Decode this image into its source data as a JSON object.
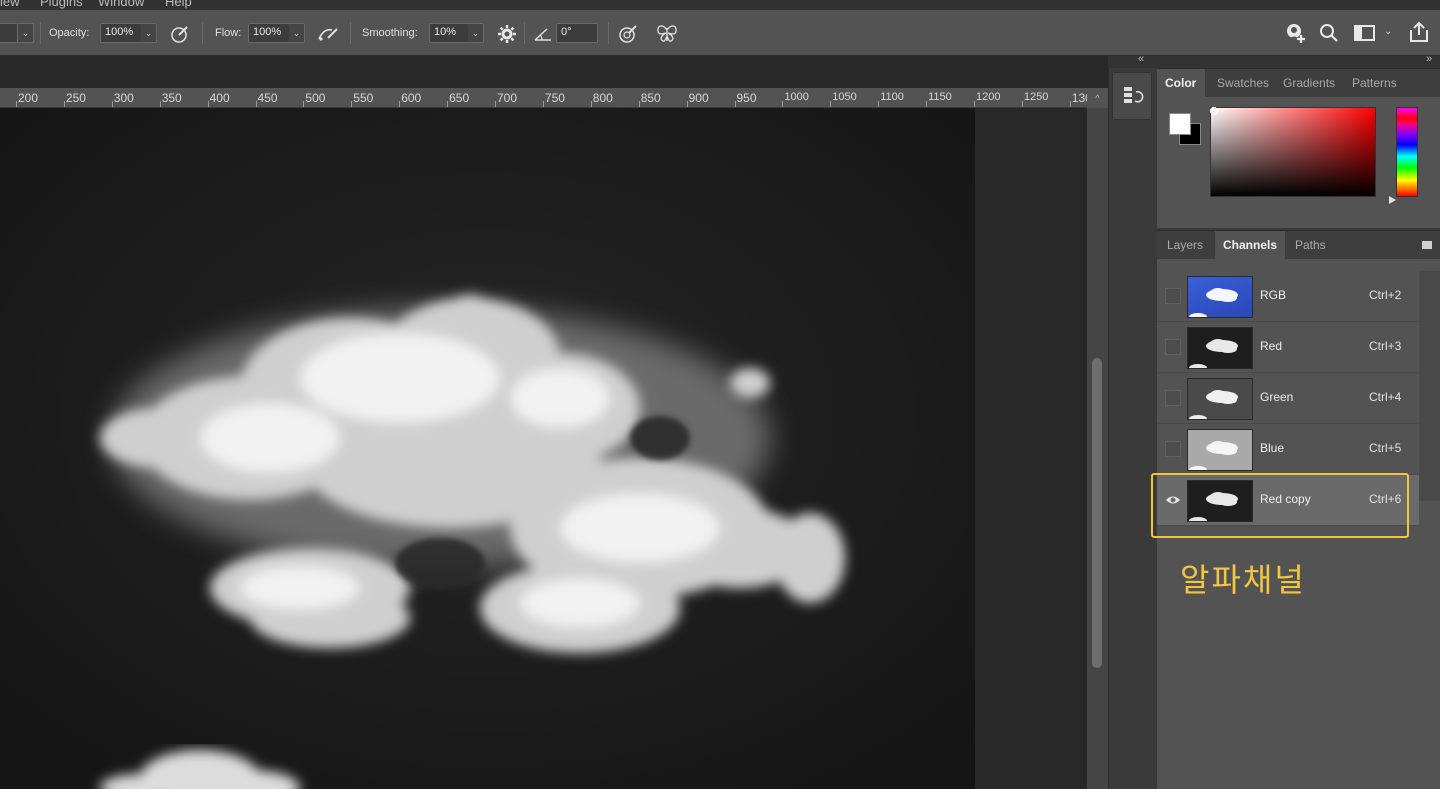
{
  "menubar": {
    "items": [
      "iew",
      "Plugins",
      "Window",
      "Help"
    ]
  },
  "options": {
    "opacity_label": "Opacity:",
    "opacity_value": "100%",
    "flow_label": "Flow:",
    "flow_value": "100%",
    "smoothing_label": "Smoothing:",
    "smoothing_value": "10%",
    "angle_value": "0°"
  },
  "ruler": {
    "labels": [
      "200",
      "250",
      "300",
      "350",
      "400",
      "450",
      "500",
      "550",
      "600",
      "650",
      "700",
      "750",
      "800",
      "850",
      "900",
      "950",
      "1000",
      "1050",
      "1100",
      "1150",
      "1200",
      "1250",
      "130"
    ]
  },
  "color_panel": {
    "tabs": [
      "Color",
      "Swatches",
      "Gradients",
      "Patterns"
    ],
    "active_tab": "Color",
    "foreground": "#ffffff",
    "background": "#000000",
    "hue": "#ff0000"
  },
  "channels_panel": {
    "tabs": [
      "Layers",
      "Channels",
      "Paths"
    ],
    "active_tab": "Channels",
    "rows": [
      {
        "name": "RGB",
        "shortcut": "Ctrl+2",
        "visible": false
      },
      {
        "name": "Red",
        "shortcut": "Ctrl+3",
        "visible": false
      },
      {
        "name": "Green",
        "shortcut": "Ctrl+4",
        "visible": false
      },
      {
        "name": "Blue",
        "shortcut": "Ctrl+5",
        "visible": false
      },
      {
        "name": "Red copy",
        "shortcut": "Ctrl+6",
        "visible": true
      }
    ]
  },
  "annotation": {
    "text": "알파채널",
    "color": "#f4c640"
  }
}
